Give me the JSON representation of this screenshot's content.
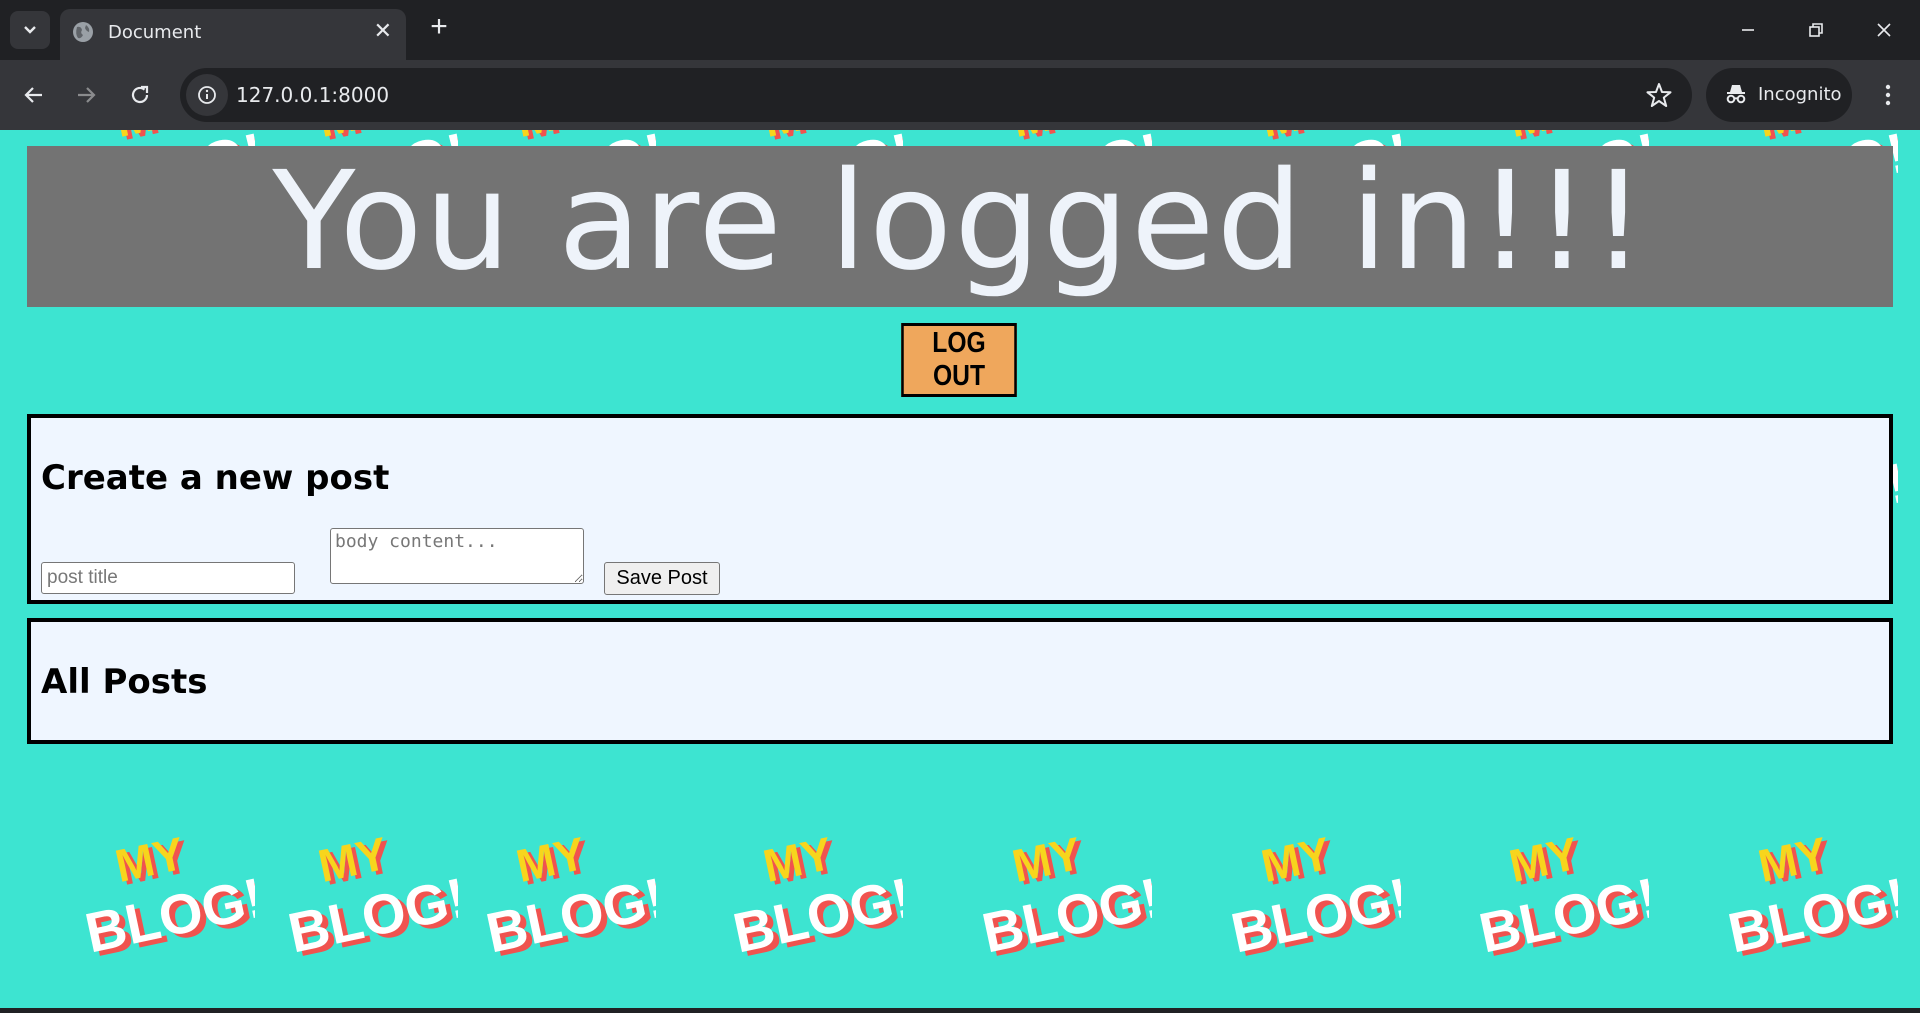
{
  "browser": {
    "tab_title": "Document",
    "url": "127.0.0.1:8000",
    "incognito_label": "Incognito"
  },
  "page": {
    "banner_text": "You are logged in!!!",
    "logout_label": "LOG OUT",
    "create_post": {
      "heading": "Create a new post",
      "title_placeholder": "post title",
      "body_placeholder": "body content...",
      "save_label": "Save Post"
    },
    "all_posts": {
      "heading": "All Posts"
    },
    "background_logo_text": [
      "MY",
      "BLOG!"
    ]
  },
  "colors": {
    "page_background": "#3de4d1",
    "banner_background": "#737373",
    "logout_button": "#efa75c",
    "panel_background": "#eff6ff",
    "logo_yellow": "#f7d51d",
    "logo_red": "#f0534f"
  }
}
